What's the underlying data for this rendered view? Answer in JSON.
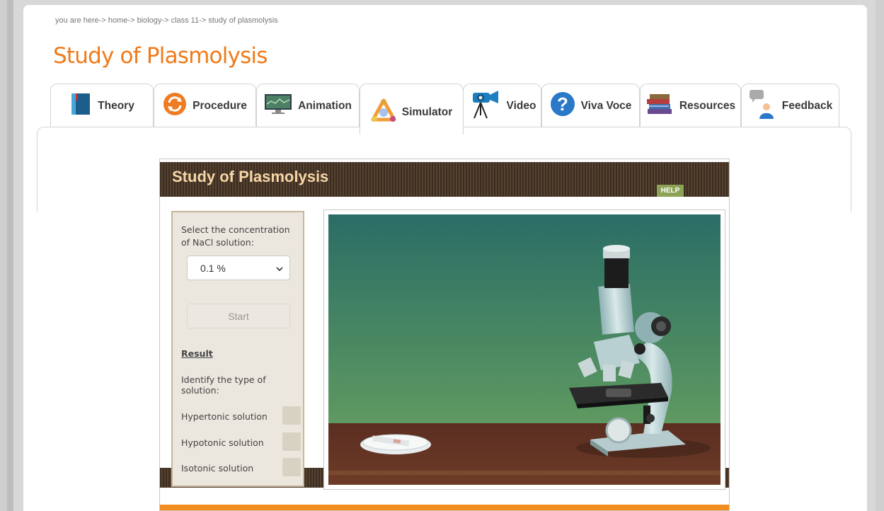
{
  "breadcrumb": "you are here-> home-> biology-> class 11-> study of plasmolysis",
  "page_title": "Study of Plasmolysis",
  "tabs": [
    {
      "label": "Theory",
      "icon": "book-icon"
    },
    {
      "label": "Procedure",
      "icon": "refresh-icon"
    },
    {
      "label": "Animation",
      "icon": "monitor-icon"
    },
    {
      "label": "Simulator",
      "icon": "simulator-icon",
      "active": true
    },
    {
      "label": "Video",
      "icon": "video-camera-icon"
    },
    {
      "label": "Viva Voce",
      "icon": "question-icon"
    },
    {
      "label": "Resources",
      "icon": "books-icon"
    },
    {
      "label": "Feedback",
      "icon": "feedback-icon"
    }
  ],
  "simulator": {
    "title": "Study of Plasmolysis",
    "help": "HELP",
    "select_label": "Select the concentration of NaCl solution:",
    "select_value": "0.1 %",
    "start_label": "Start",
    "result_label": "Result",
    "identify_label": "Identify the type of solution:",
    "options": [
      "Hypertonic solution",
      "Hypotonic solution",
      "Isotonic solution"
    ]
  },
  "colors": {
    "title": "#f07a1a",
    "help_badge": "#8ca255",
    "header_bg": "#3b2d22",
    "footer_bar": "#f28c1f"
  }
}
